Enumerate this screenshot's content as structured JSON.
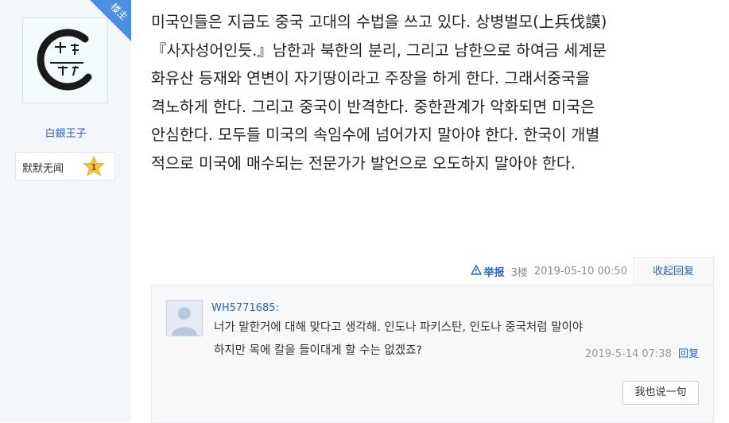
{
  "sidebar": {
    "louzhu_badge": "楼主",
    "username": "白銀王子",
    "level_title": "默默无闻",
    "level_number": "1"
  },
  "post": {
    "lines": [
      "미국인들은 지금도 중국 고대의 수법을 쓰고 있다. 상병벌모(上兵伐謨)",
      "『사자성어인듯.』남한과 북한의 분리, 그리고 남한으로 하여금 세계문",
      "화유산 등재와 연변이 자기땅이라고 주장을 하게 한다. 그래서중국을",
      "격노하게 한다. 그리고 중국이 반격한다. 중한관계가 악화되면 미국은",
      "안심한다. 모두들 미국의 속임수에 넘어가지 말아야 한다. 한국이 개별",
      "적으로 미국에 매수되는 전문가가  발언으로 오도하지 말아야 한다."
    ]
  },
  "meta": {
    "report_label": "举报",
    "floor": "3楼",
    "datetime": "2019-05-10 00:50",
    "fold_label": "收起回复"
  },
  "reply": {
    "user": "WH5771685:",
    "lines": [
      "너가 말한거에 대해 맞다고 생각해. 인도나 파키스탄, 인도나 중국처럼 말이야",
      "하지만 목에 칼을 들이대게 할 수는 없겠죠?"
    ],
    "time": "2019-5-14 07:38",
    "reply_label": "回复",
    "say_button": "我也说一句"
  },
  "colors": {
    "link": "#2d64b3",
    "badge": "#4e8ee0",
    "sidebar_bg": "#f3f6fb"
  }
}
